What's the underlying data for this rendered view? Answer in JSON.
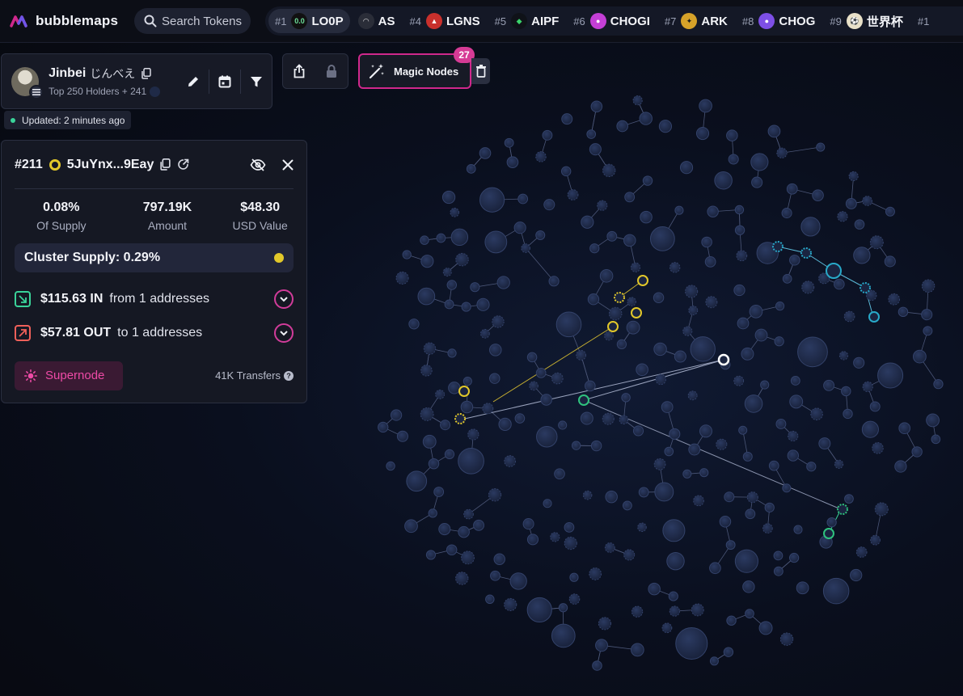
{
  "app": {
    "name": "bubblemaps"
  },
  "search": {
    "placeholder": "Search Tokens"
  },
  "ticker": [
    {
      "rank": "#1",
      "symbol": "LO0P",
      "icon": "loop-token-icon",
      "color": "#111111",
      "fg": "#6de09a",
      "glyph": "0.0",
      "active": true
    },
    {
      "rank": "",
      "symbol": "AS",
      "icon": "as-token-icon",
      "color": "#2a2d38",
      "fg": "#e6e6e6",
      "glyph": "◠",
      "active": false
    },
    {
      "rank": "#4",
      "symbol": "LGNS",
      "icon": "lgns-token-icon",
      "color": "#c9302c",
      "fg": "#ffffff",
      "glyph": "▲",
      "active": false
    },
    {
      "rank": "#5",
      "symbol": "AIPF",
      "icon": "aipf-token-icon",
      "color": "#0f1218",
      "fg": "#3bd36b",
      "glyph": "◆",
      "active": false
    },
    {
      "rank": "#6",
      "symbol": "CHOGI",
      "icon": "chogi-token-icon",
      "color": "#c43fd6",
      "fg": "#ffffff",
      "glyph": "●",
      "active": false
    },
    {
      "rank": "#7",
      "symbol": "ARK",
      "icon": "ark-token-icon",
      "color": "#d6a229",
      "fg": "#1a1a1a",
      "glyph": "✦",
      "active": false
    },
    {
      "rank": "#8",
      "symbol": "CHOG",
      "icon": "chog-token-icon",
      "color": "#7d4fe6",
      "fg": "#ffffff",
      "glyph": "●",
      "active": false
    },
    {
      "rank": "#9",
      "symbol": "世界杯",
      "icon": "worldcup-token-icon",
      "color": "#e8e0c8",
      "fg": "#222",
      "glyph": "⚽",
      "active": false
    },
    {
      "rank": "#1",
      "symbol": "",
      "icon": "token-icon",
      "color": "#222",
      "fg": "#fff",
      "glyph": "",
      "active": false
    }
  ],
  "holder": {
    "name": "Jinbei",
    "name_jp": "じんべえ",
    "subtitle": "Top 250 Holders + 241",
    "updated": "Updated: 2 minutes ago"
  },
  "magic_nodes": {
    "label": "Magic Nodes",
    "count": "27"
  },
  "detail": {
    "rank": "#211",
    "address": "5JuYnx...9Eay",
    "stats": [
      {
        "value": "0.08%",
        "label": "Of Supply"
      },
      {
        "value": "797.19K",
        "label": "Amount"
      },
      {
        "value": "$48.30",
        "label": "USD Value"
      }
    ],
    "cluster_supply": "Cluster Supply: 0.29%",
    "inflow": {
      "amount": "$115.63 IN",
      "desc": "from 1 addresses"
    },
    "outflow": {
      "amount": "$57.81 OUT",
      "desc": "to 1 addresses"
    },
    "supernode_label": "Supernode",
    "transfers": "41K Transfers"
  },
  "colors": {
    "accent_pink": "#d0288c",
    "cluster_yellow": "#e2c82a",
    "cluster_green": "#2fc27e",
    "cluster_cyan": "#28a9c9",
    "bubble": "#1f2a47"
  }
}
